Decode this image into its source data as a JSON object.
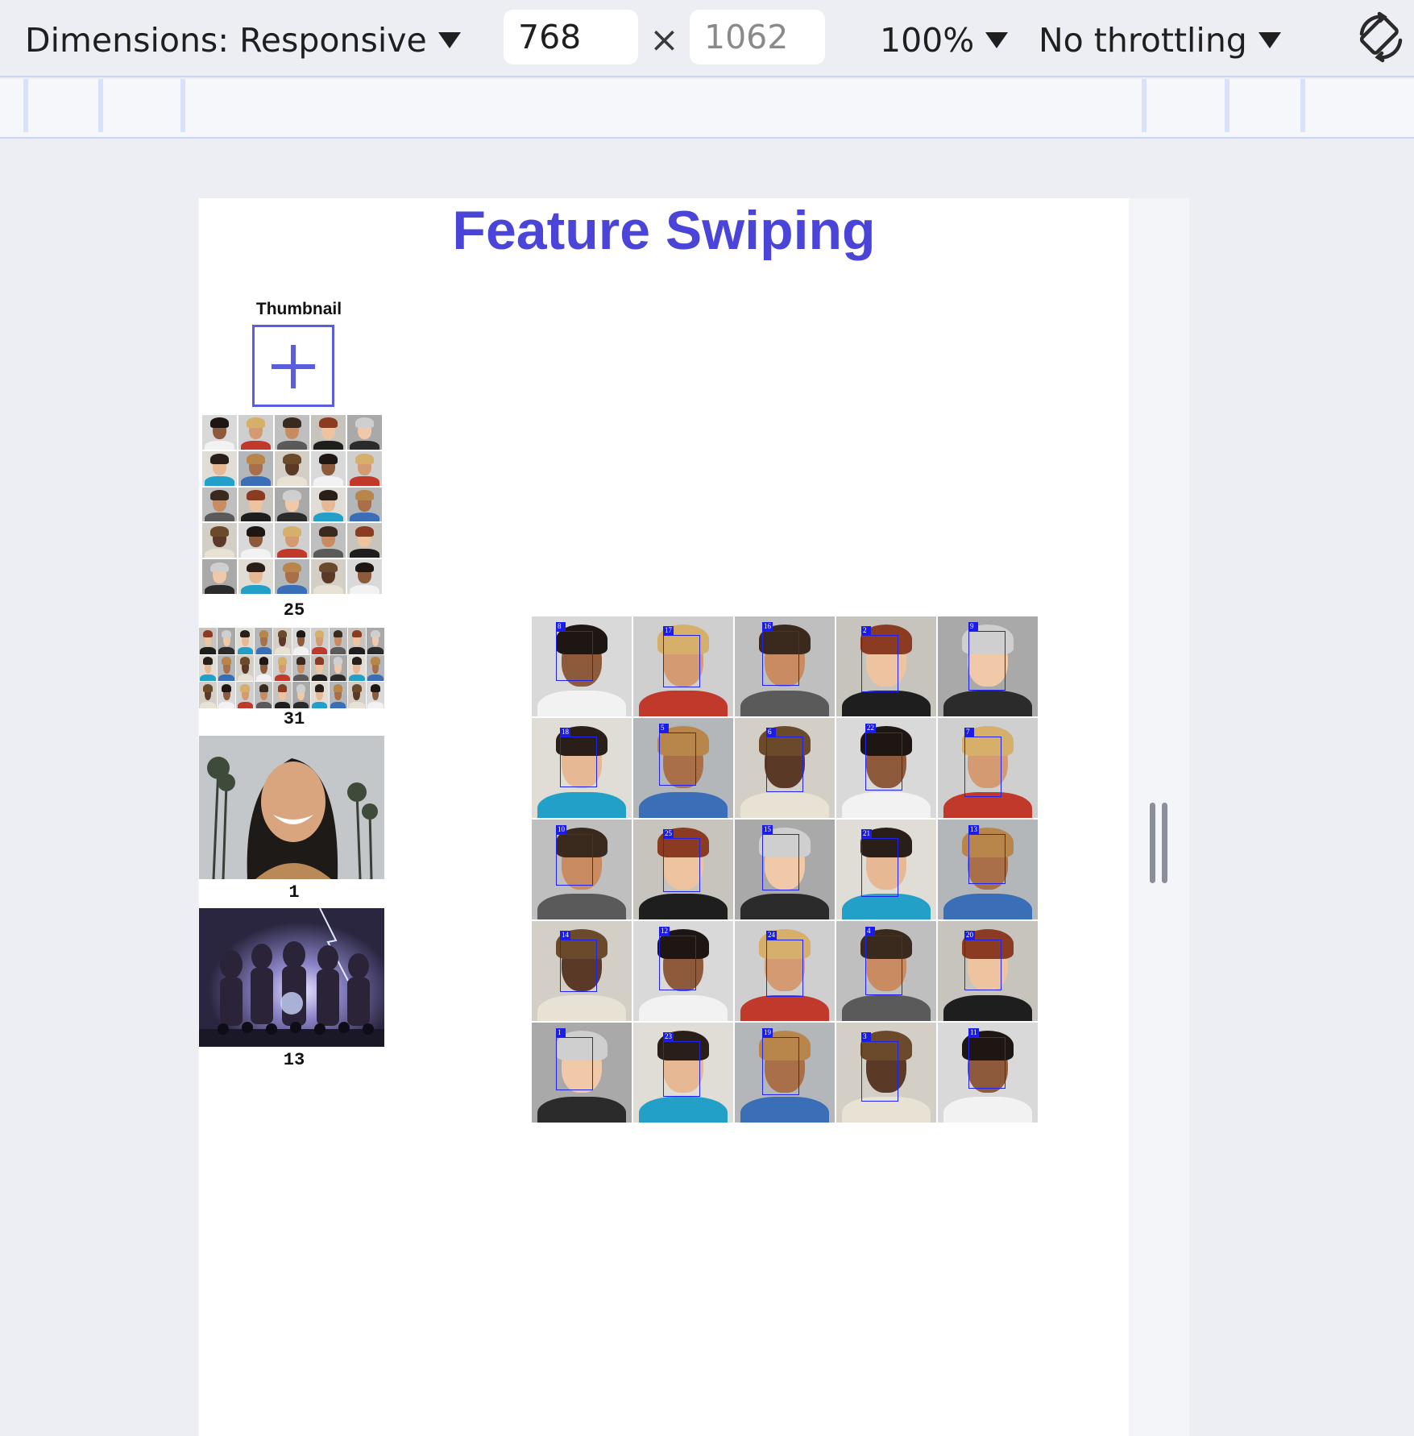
{
  "devtools": {
    "dimensions_label": "Dimensions: Responsive",
    "width_value": "768",
    "height_placeholder": "1062",
    "times": "×",
    "zoom": "100%",
    "throttling": "No throttling"
  },
  "page": {
    "title": "Feature Swiping",
    "thumbnail_label": "Thumbnail",
    "thumbnails": [
      {
        "name": "face-grid-25",
        "count": "25"
      },
      {
        "name": "face-grid-31",
        "count": "31"
      },
      {
        "name": "smiling-woman",
        "count": "1"
      },
      {
        "name": "group-poster",
        "count": "13"
      }
    ],
    "detections": [
      "8",
      "17",
      "16",
      "2",
      "9",
      "18",
      "5",
      "6",
      "22",
      "7",
      "10",
      "25",
      "15",
      "21",
      "13",
      "14",
      "12",
      "24",
      "4",
      "20",
      "1",
      "23",
      "19",
      "3",
      "11"
    ]
  },
  "colors": {
    "accent": "#4b44d8",
    "box": "#2222ee"
  }
}
